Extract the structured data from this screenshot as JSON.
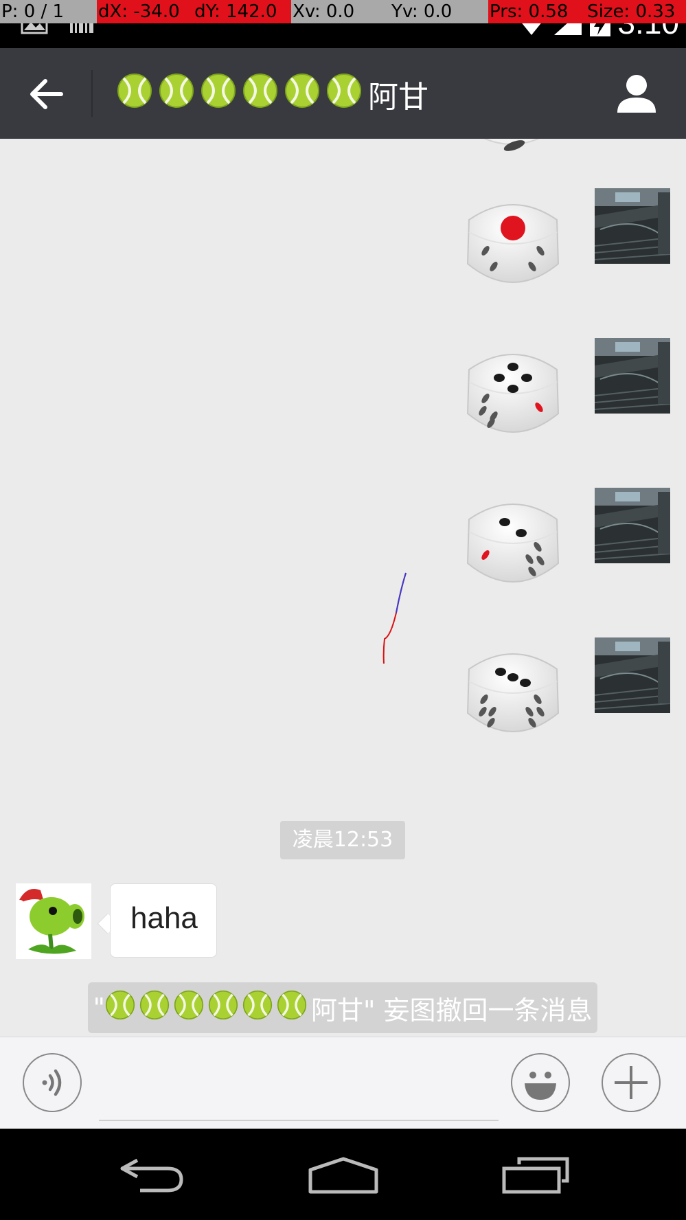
{
  "debug": {
    "pointer": "P: 0 / 1",
    "dx": "dX: -34.0",
    "dy": "dY: 142.0",
    "xv": "Xv: 0.0",
    "yv": "Yv: 0.0",
    "prs": "Prs: 0.58",
    "size": "Size: 0.33"
  },
  "status_bar": {
    "time": "3:10",
    "icons": [
      "image-icon",
      "barcode-icon",
      "wifi-icon",
      "signal-icon",
      "battery-icon"
    ]
  },
  "header": {
    "title_text": "阿甘",
    "title_emoji_count": 6,
    "back_icon": "arrow-left-icon",
    "profile_icon": "person-icon"
  },
  "messages": [
    {
      "type": "dice",
      "sender": "self",
      "value": 1
    },
    {
      "type": "dice",
      "sender": "self",
      "value": 4
    },
    {
      "type": "dice",
      "sender": "self",
      "value": 2
    },
    {
      "type": "dice",
      "sender": "self",
      "value": 3
    }
  ],
  "timestamp": "凌晨12:53",
  "peer_message": {
    "text": "haha",
    "avatar": "peashooter-avatar"
  },
  "system_notice": {
    "prefix": "\"",
    "suffix": "阿甘\" 妄图撤回一条消息",
    "emoji_count": 6
  },
  "input_bar": {
    "placeholder": "",
    "voice_icon": "voice-icon",
    "emoji_icon": "smiley-icon",
    "plus_icon": "plus-icon"
  },
  "nav_bar": {
    "icons": [
      "back-nav-icon",
      "home-nav-icon",
      "recents-nav-icon"
    ]
  },
  "colors": {
    "header": "#393a3f",
    "chat_bg": "#ebebeb",
    "debug_red": "#e0111b",
    "die_pip_red": "#e0141e"
  }
}
